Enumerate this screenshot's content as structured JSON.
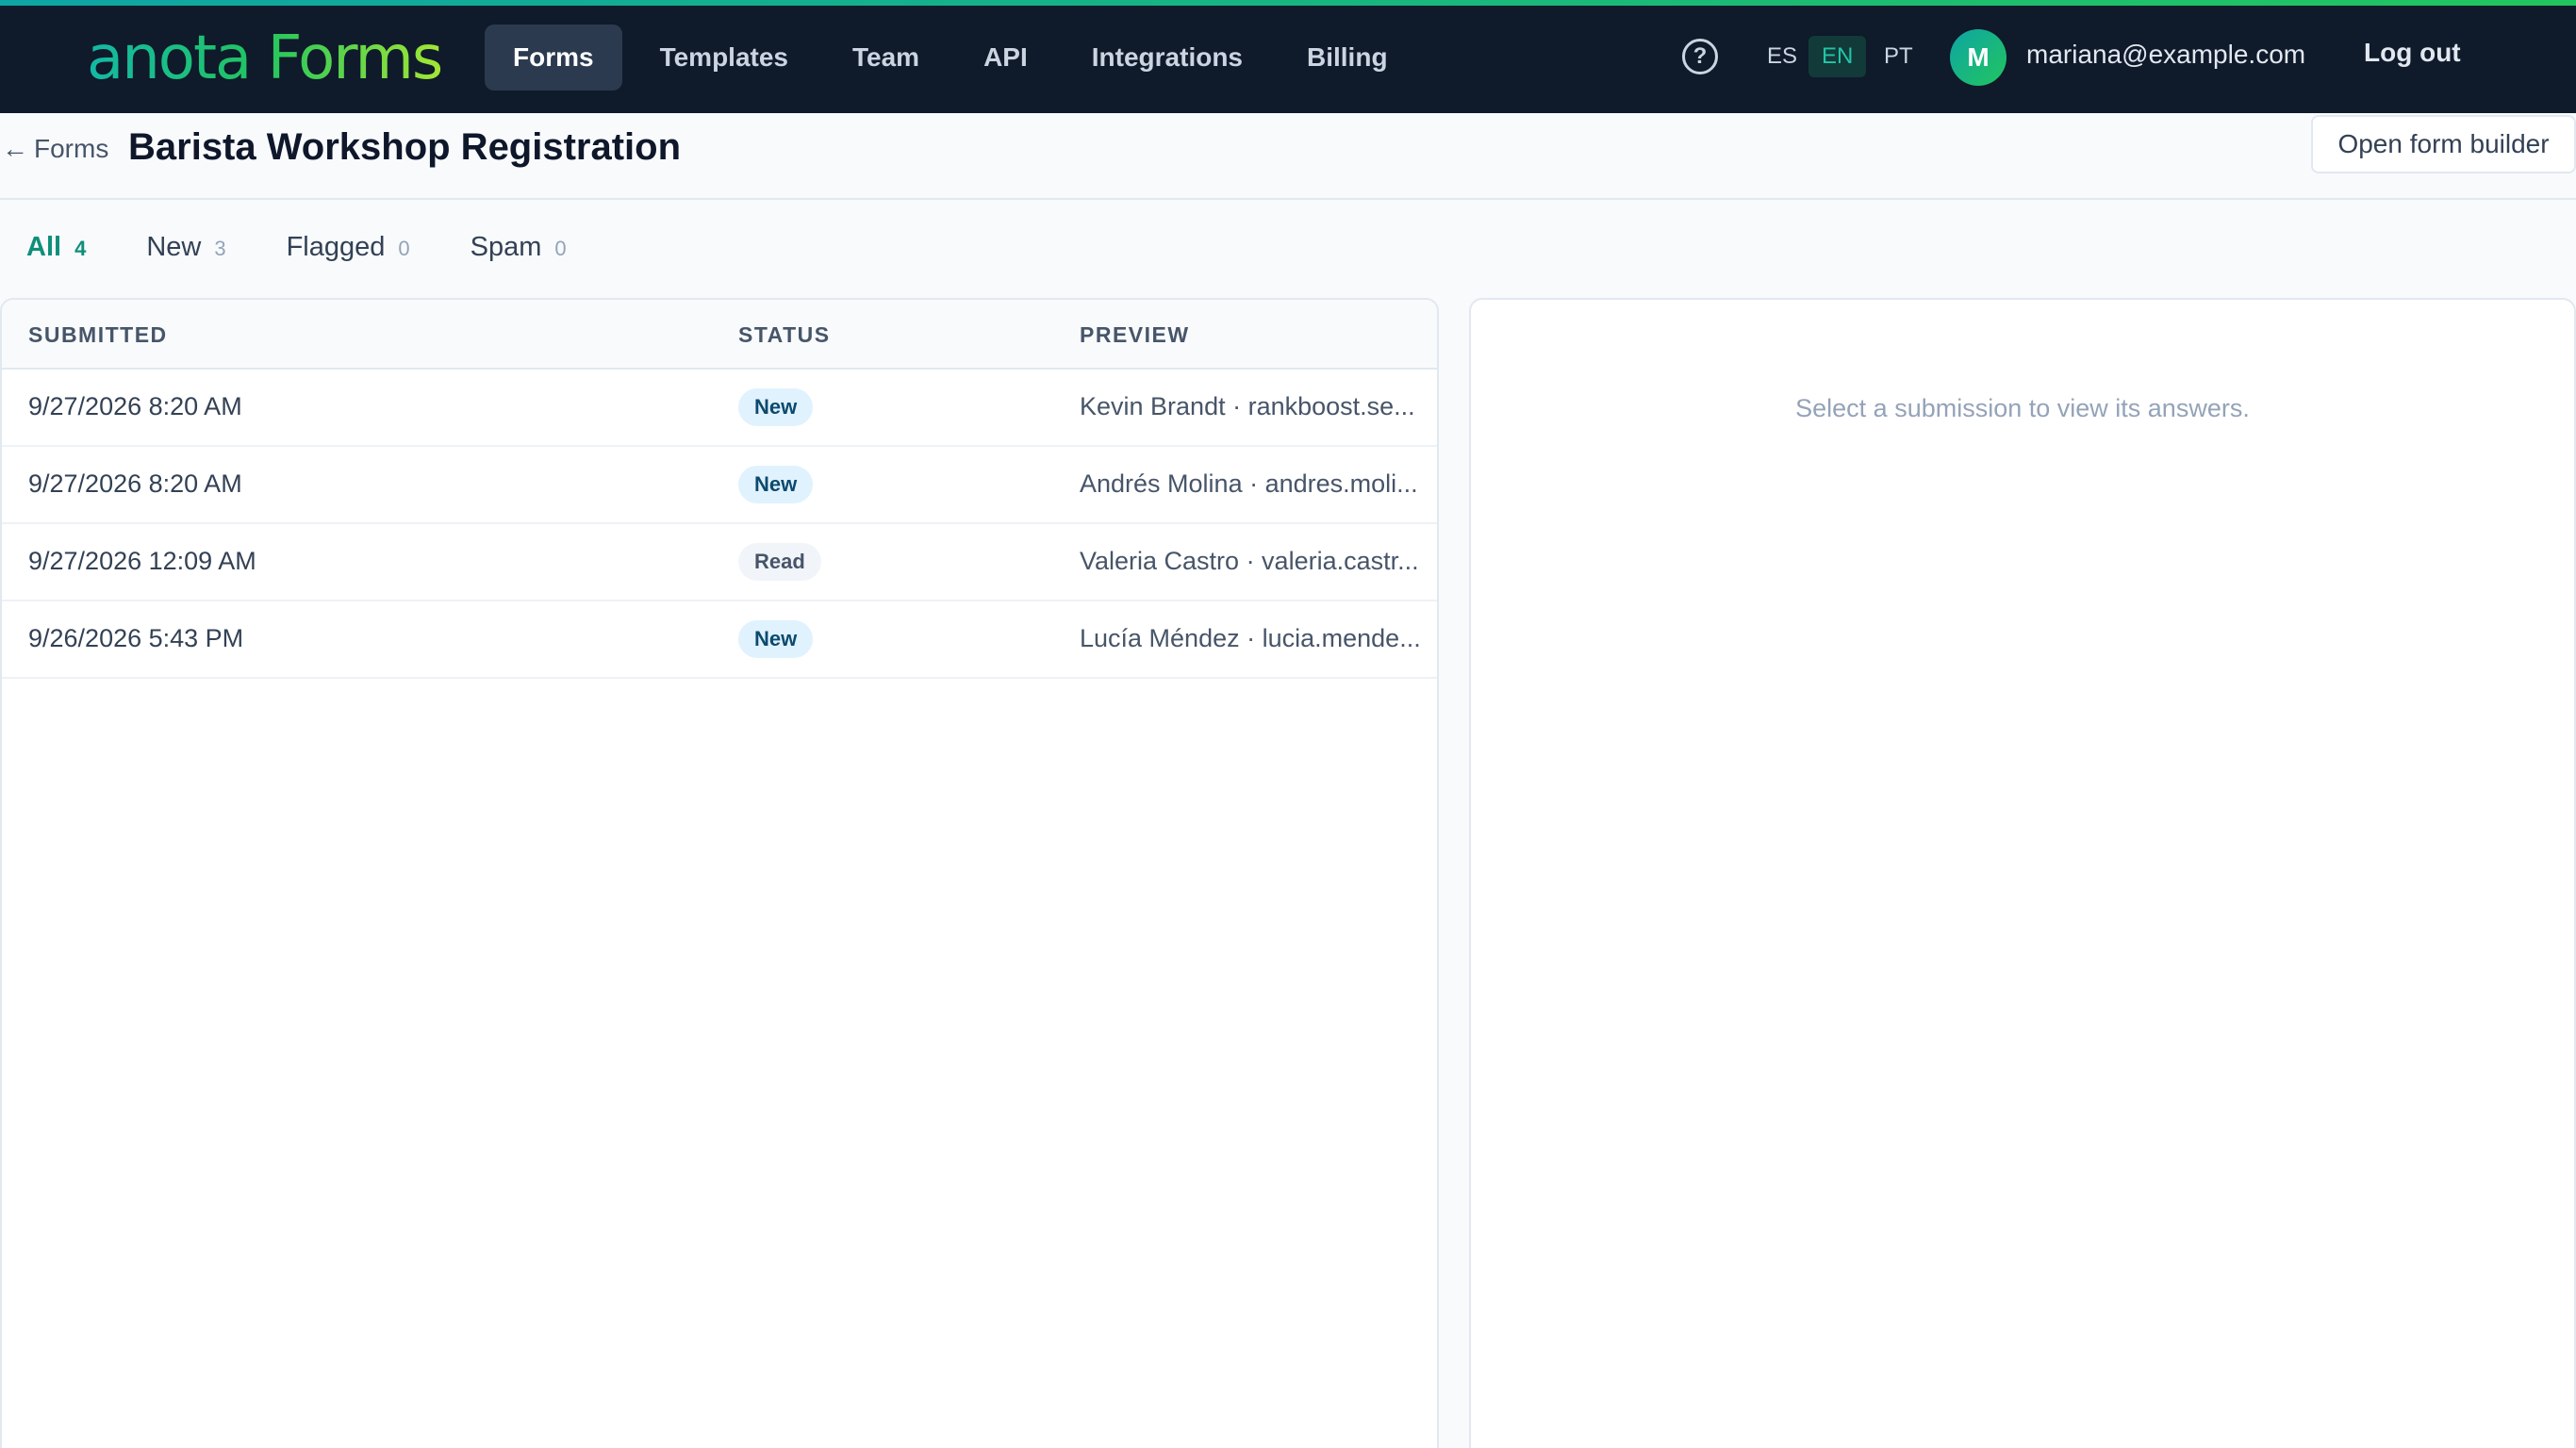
{
  "app": {
    "logo": "anota Forms"
  },
  "nav": {
    "items": [
      {
        "label": "Forms",
        "active": true
      },
      {
        "label": "Templates",
        "active": false
      },
      {
        "label": "Team",
        "active": false
      },
      {
        "label": "API",
        "active": false
      },
      {
        "label": "Integrations",
        "active": false
      },
      {
        "label": "Billing",
        "active": false
      }
    ],
    "help_icon": "question-circle-icon",
    "help_glyph": "?",
    "languages": [
      {
        "code": "ES",
        "active": false
      },
      {
        "code": "EN",
        "active": true
      },
      {
        "code": "PT",
        "active": false
      }
    ],
    "user": {
      "initial": "M",
      "email": "mariana@example.com"
    },
    "logout_label": "Log out"
  },
  "header": {
    "back_arrow": "←",
    "back_label": "Forms",
    "title": "Barista Workshop Registration",
    "builder_button": "Open form builder"
  },
  "tabs": [
    {
      "label": "All",
      "count": "4",
      "active": true
    },
    {
      "label": "New",
      "count": "3",
      "active": false
    },
    {
      "label": "Flagged",
      "count": "0",
      "active": false
    },
    {
      "label": "Spam",
      "count": "0",
      "active": false
    }
  ],
  "table": {
    "columns": [
      "SUBMITTED",
      "STATUS",
      "PREVIEW"
    ],
    "rows": [
      {
        "submitted": "9/27/2026 8:20 AM",
        "status": "New",
        "preview": "Kevin Brandt · rankboost.se..."
      },
      {
        "submitted": "9/27/2026 8:20 AM",
        "status": "New",
        "preview": "Andrés Molina · andres.moli..."
      },
      {
        "submitted": "9/27/2026 12:09 AM",
        "status": "Read",
        "preview": "Valeria Castro · valeria.castr..."
      },
      {
        "submitted": "9/26/2026 5:43 PM",
        "status": "New",
        "preview": "Lucía Méndez · lucia.mende..."
      }
    ]
  },
  "detail": {
    "empty_message": "Select a submission to view its answers."
  },
  "colors": {
    "topbar": "#0f1a2b",
    "accent": "#0f8f7a",
    "badge_new_bg": "#e0f2fe",
    "badge_read_bg": "#f1f5f9"
  }
}
